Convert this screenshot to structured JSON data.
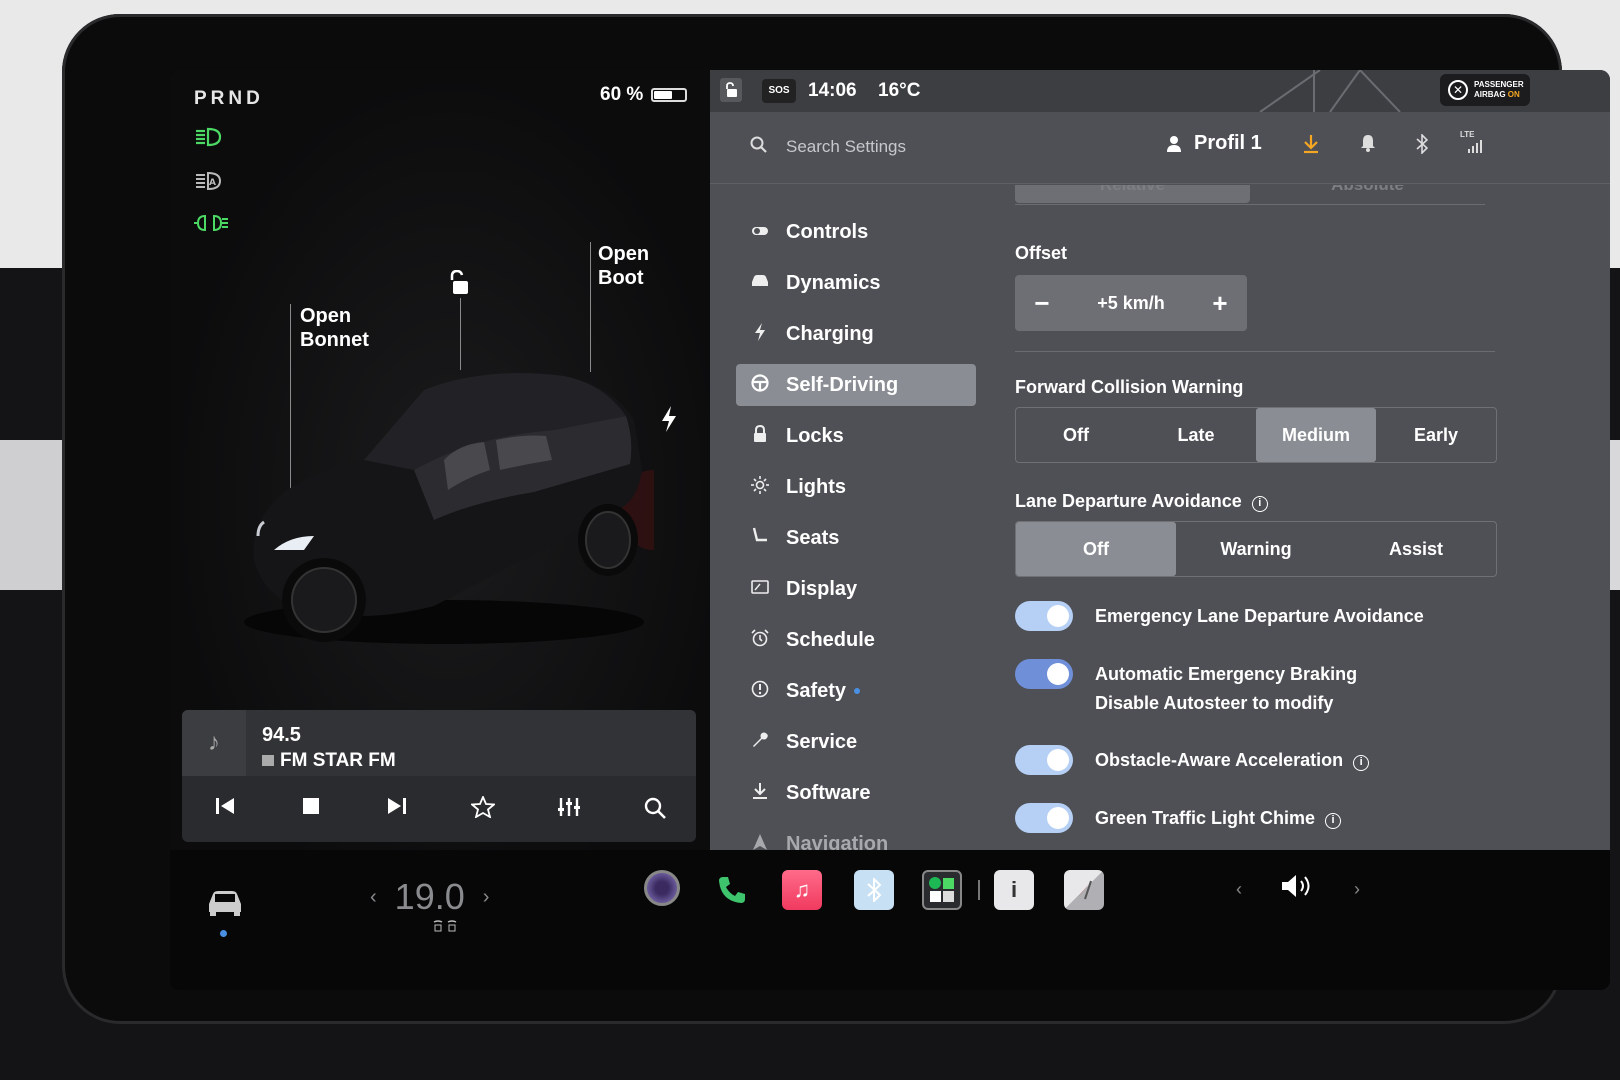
{
  "vehicle": {
    "gear": "PRND",
    "battery_percent": "60 %",
    "battery_level": 0.6,
    "lights": [
      "headlights-on-icon",
      "auto-headlights-icon",
      "fog-lights-icon"
    ],
    "open_bonnet": [
      "Open",
      "Bonnet"
    ],
    "open_boot": [
      "Open",
      "Boot"
    ]
  },
  "media": {
    "frequency": "94.5",
    "station": "FM STAR FM",
    "controls": [
      "previous-icon",
      "stop-icon",
      "next-icon",
      "favorite-icon",
      "equalizer-icon",
      "search-icon"
    ]
  },
  "status": {
    "sos": "SOS",
    "time": "14:06",
    "temperature": "16°C",
    "airbag_line1": "PASSENGER",
    "airbag_line2": "AIRBAG",
    "airbag_on": "ON"
  },
  "header": {
    "search_placeholder": "Search Settings",
    "profile": "Profil 1",
    "network": "LTE"
  },
  "nav": {
    "items": [
      {
        "label": "Controls",
        "icon": "toggle-icon"
      },
      {
        "label": "Dynamics",
        "icon": "car-icon"
      },
      {
        "label": "Charging",
        "icon": "bolt-icon"
      },
      {
        "label": "Self-Driving",
        "icon": "steering-wheel-icon",
        "active": true
      },
      {
        "label": "Locks",
        "icon": "lock-icon"
      },
      {
        "label": "Lights",
        "icon": "sun-icon"
      },
      {
        "label": "Seats",
        "icon": "seat-icon"
      },
      {
        "label": "Display",
        "icon": "display-icon"
      },
      {
        "label": "Schedule",
        "icon": "alarm-icon"
      },
      {
        "label": "Safety",
        "icon": "alert-icon",
        "badge": true
      },
      {
        "label": "Service",
        "icon": "wrench-icon"
      },
      {
        "label": "Software",
        "icon": "download-icon"
      },
      {
        "label": "Navigation",
        "icon": "navigation-icon"
      }
    ]
  },
  "settings": {
    "speed_mode": {
      "options": [
        "Relative",
        "Absolute"
      ],
      "selected": "Relative"
    },
    "offset": {
      "label": "Offset",
      "value": "+5 km/h",
      "minus": "−",
      "plus": "+"
    },
    "fcw": {
      "label": "Forward Collision Warning",
      "options": [
        "Off",
        "Late",
        "Medium",
        "Early"
      ],
      "selected": "Medium"
    },
    "lda": {
      "label": "Lane Departure Avoidance",
      "options": [
        "Off",
        "Warning",
        "Assist"
      ],
      "selected": "Off"
    },
    "toggles": [
      {
        "label": "Emergency Lane Departure Avoidance",
        "on": true
      },
      {
        "label": "Automatic Emergency Braking",
        "sub": "Disable Autosteer to modify",
        "on": true
      },
      {
        "label": "Obstacle-Aware Acceleration",
        "on": true,
        "info": true
      },
      {
        "label": "Green Traffic Light Chime",
        "on": true,
        "info": true
      }
    ]
  },
  "dock": {
    "temperature": "19.0",
    "apps": [
      "camera-icon",
      "phone-icon",
      "music-icon",
      "bluetooth-icon",
      "spotify-icon",
      "manual-icon",
      "navigation-app-icon"
    ]
  }
}
